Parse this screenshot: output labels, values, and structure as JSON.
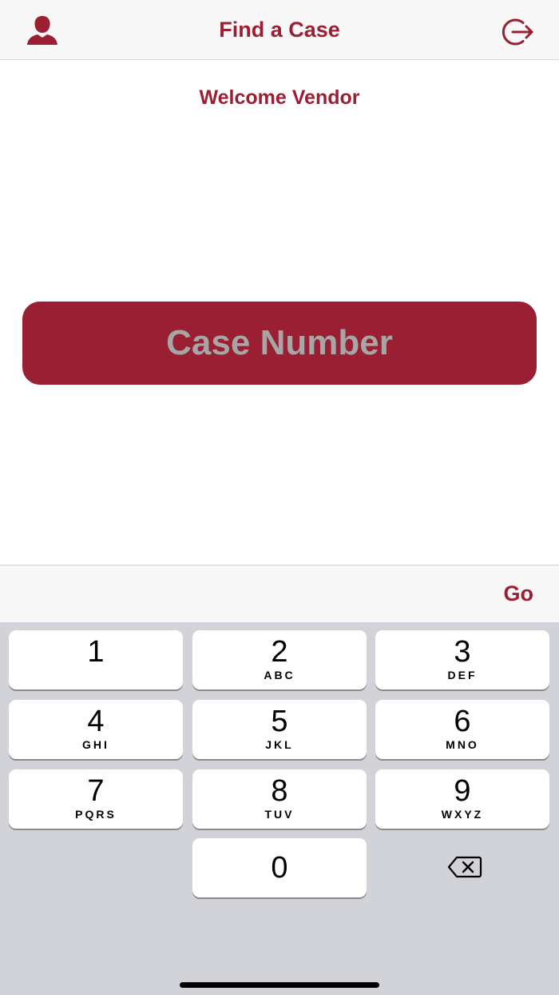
{
  "nav": {
    "title": "Find a Case",
    "profile_icon": "person-icon",
    "logout_icon": "logout-icon"
  },
  "welcome": "Welcome Vendor",
  "case_input": {
    "placeholder": "Case Number",
    "value": ""
  },
  "accessory": {
    "go_label": "Go"
  },
  "keypad": {
    "keys": [
      {
        "digit": "1",
        "letters": ""
      },
      {
        "digit": "2",
        "letters": "ABC"
      },
      {
        "digit": "3",
        "letters": "DEF"
      },
      {
        "digit": "4",
        "letters": "GHI"
      },
      {
        "digit": "5",
        "letters": "JKL"
      },
      {
        "digit": "6",
        "letters": "MNO"
      },
      {
        "digit": "7",
        "letters": "PQRS"
      },
      {
        "digit": "8",
        "letters": "TUV"
      },
      {
        "digit": "9",
        "letters": "WXYZ"
      },
      {
        "digit": "0",
        "letters": ""
      }
    ],
    "delete_icon": "backspace-icon"
  },
  "colors": {
    "accent": "#9b1f33",
    "placeholder": "#a6a6a6",
    "keyboard_bg": "#d1d3d9"
  }
}
